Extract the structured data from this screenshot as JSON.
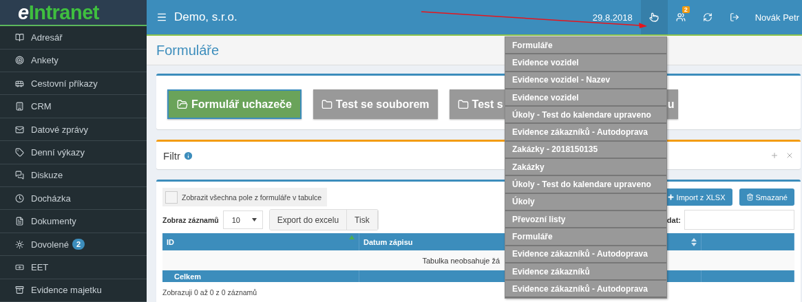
{
  "logo": {
    "prefix": "e",
    "name": "Intranet"
  },
  "header": {
    "company": "Demo, s.r.o.",
    "date": "29.8.2018",
    "user": "Novák Petr",
    "tools": [
      {
        "kind": "pointer",
        "selected": true
      },
      {
        "kind": "users",
        "selected": false,
        "badge": "2"
      },
      {
        "kind": "refresh",
        "selected": false
      },
      {
        "kind": "logout",
        "selected": false
      }
    ]
  },
  "sidebar": {
    "items": [
      {
        "label": "Adresář"
      },
      {
        "label": "Ankety"
      },
      {
        "label": "Cestovní příkazy"
      },
      {
        "label": "CRM"
      },
      {
        "label": "Datové zprávy"
      },
      {
        "label": "Denní výkazy"
      },
      {
        "label": "Diskuze"
      },
      {
        "label": "Docházka"
      },
      {
        "label": "Dokumenty"
      },
      {
        "label": "Dovolené",
        "badge": "2"
      },
      {
        "label": "EET"
      },
      {
        "label": "Evidence majetku"
      }
    ]
  },
  "page": {
    "title": "Formuláře"
  },
  "form_buttons": [
    {
      "label": "Formulář uchazeče",
      "primary": true
    },
    {
      "label": "Test se souborem",
      "primary": false
    },
    {
      "label": "Test s",
      "tail": "u",
      "primary": false
    }
  ],
  "filter": {
    "title": "Filtr"
  },
  "table": {
    "show_all": {
      "label": "Zobrazit všechna pole z formuláře v tabulce",
      "checked": false
    },
    "actions": [
      {
        "label": "Import z XLSX"
      },
      {
        "label": "Smazané"
      }
    ],
    "length_label": "Zobraz záznamů",
    "length_value": "10",
    "exports": [
      "Export do excelu",
      "Tisk"
    ],
    "search_label": "dat:",
    "columns": [
      {
        "label": "ID",
        "kind": "sorted"
      },
      {
        "label": "Datum zápisu",
        "kind": "plain"
      },
      {
        "kind": "sortable"
      },
      {
        "kind": "plain"
      }
    ],
    "empty_message": "Tabulka neobsahuje žá",
    "footer": "Celkem",
    "info": "Zobrazuji 0 až 0 z 0 záznamů"
  },
  "dropdown": {
    "items": [
      "Formuláře",
      "Evidence vozidel",
      "Evidence vozidel - Nazev",
      "Evidence vozidel",
      "Úkoly - Test do kalendare upraveno",
      "Evidence zákazníků - Autodoprava",
      "Zakázky - 2018150135",
      "Zakázky",
      "Úkoly - Test do kalendare upraveno",
      "Úkoly",
      "Převozní listy",
      "Formuláře",
      "Evidence zákazníků - Autodoprava",
      "Evidence zákazníků",
      "Evidence zákazníků - Autodoprava"
    ]
  },
  "annotation": {
    "kind": "arrow"
  }
}
